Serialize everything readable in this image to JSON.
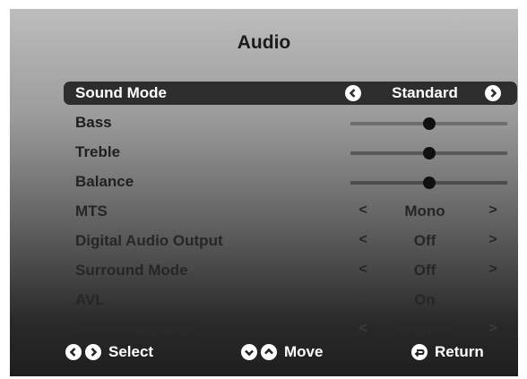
{
  "menu": {
    "title": "Audio",
    "items": [
      {
        "label": "Sound Mode",
        "type": "select",
        "value": "Standard",
        "selected": true,
        "label_color": "#ffffff",
        "arrow_color": "#ffffff"
      },
      {
        "label": "Bass",
        "type": "slider",
        "level": 0.5,
        "label_color": "#1c1c1c",
        "track_color": "#6e6e6e"
      },
      {
        "label": "Treble",
        "type": "slider",
        "level": 0.5,
        "label_color": "#1f1f1f",
        "track_color": "#5a5a5a"
      },
      {
        "label": "Balance",
        "type": "slider",
        "level": 0.5,
        "label_color": "#222222",
        "track_color": "#4c4c4c"
      },
      {
        "label": "MTS",
        "type": "select",
        "value": "Mono",
        "label_color": "#252525",
        "arrow_color": "#252525"
      },
      {
        "label": "Digital Audio Output",
        "type": "select",
        "value": "Off",
        "label_color": "#262626",
        "arrow_color": "#262626"
      },
      {
        "label": "Surround Mode",
        "type": "select",
        "value": "Off",
        "label_color": "#262626",
        "arrow_color": "#262626"
      },
      {
        "label": "AVL",
        "type": "select",
        "value": "On",
        "label_color": "#262626",
        "arrow_color": "#3a3a3a"
      },
      {
        "label": "Audio Language",
        "type": "select",
        "value": "English",
        "label_color": "#2a2a2a",
        "arrow_color": "#3c3c3c"
      }
    ]
  },
  "footer": {
    "select_label": "Select",
    "move_label": "Move",
    "return_label": "Return"
  },
  "icons": {
    "left": "chevron-left-icon",
    "right": "chevron-right-icon",
    "down": "chevron-down-icon",
    "up": "chevron-up-icon",
    "return": "return-icon"
  }
}
